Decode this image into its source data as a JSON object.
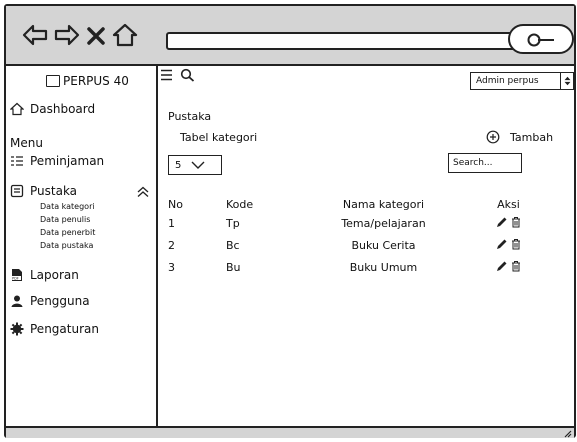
{
  "sidebar": {
    "brand": "PERPUS 40",
    "dashboard": "Dashboard",
    "menu_heading": "Menu",
    "peminjaman": "Peminjaman",
    "pustaka": "Pustaka",
    "pustaka_sub": [
      "Data kategori",
      "Data penulis",
      "Data penerbit",
      "Data pustaka"
    ],
    "laporan": "Laporan",
    "pengguna": "Pengguna",
    "pengaturan": "Pengaturan"
  },
  "header": {
    "user_select": "Admin perpus"
  },
  "main": {
    "page_title": "Pustaka",
    "table_title": "Tabel kategori",
    "add_label": "Tambah",
    "entries_value": "5",
    "search_placeholder": "Search...",
    "columns": [
      "No",
      "Kode",
      "Nama kategori",
      "Aksi"
    ],
    "rows": [
      {
        "no": "1",
        "kode": "Tp",
        "nama": "Tema/pelajaran"
      },
      {
        "no": "2",
        "kode": "Bc",
        "nama": "Buku Cerita"
      },
      {
        "no": "3",
        "kode": "Bu",
        "nama": "Buku Umum"
      }
    ]
  },
  "icons": {
    "back": "back-arrow-icon",
    "forward": "forward-arrow-icon",
    "close": "close-icon",
    "home": "home-icon",
    "menu": "hamburger-menu-icon",
    "search": "search-icon",
    "edit": "pencil-icon",
    "delete": "trash-icon"
  },
  "colors": {
    "chrome": "#d4d4d4",
    "ink": "#222222"
  }
}
